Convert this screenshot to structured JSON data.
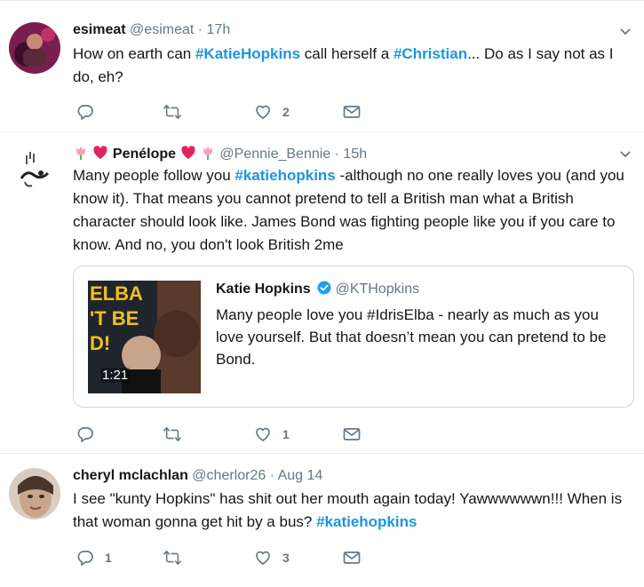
{
  "colors": {
    "link": "#1b95e0",
    "secondary": "#657786",
    "border": "#e6ecf0",
    "heart_emoji": "#e0245e"
  },
  "tweets": [
    {
      "name": "esimeat",
      "handle": "@esimeat",
      "dot": "·",
      "time": "17h",
      "text_parts": [
        "How on earth can ",
        "#KatieHopkins",
        " call herself a ",
        "#Christian",
        "... Do as I say not as I do, eh?"
      ],
      "reply_count": "",
      "retweet_count": "",
      "like_count": "2"
    },
    {
      "name": "Penélope",
      "handle": "@Pennie_Bennie",
      "dot": "·",
      "time": "15h",
      "name_icons": [
        "tulip-icon",
        "heart-icon"
      ],
      "text_parts": [
        "Many people follow you ",
        "#katiehopkins",
        " -although no one really loves you (and you know it). That means you cannot pretend to tell a British man what a British character should look like. James Bond was fighting people like you if you care to know. And no, you don't look British 2me"
      ],
      "quote": {
        "name": "Katie Hopkins",
        "handle": "@KTHopkins",
        "text": "Many people love you #IdrisElba - nearly as much as you love yourself. But that doesn’t mean you can pretend to be Bond.",
        "media_text": [
          "ELBA",
          "'T BE",
          "D!"
        ],
        "duration": "1:21"
      },
      "reply_count": "",
      "retweet_count": "",
      "like_count": "1"
    },
    {
      "name": "cheryl mclachlan",
      "handle": "@cherlor26",
      "dot": "·",
      "time": "Aug 14",
      "text_parts": [
        "I see \"kunty Hopkins\" has shit out her mouth again today! Yawwwwwwn!!! When is that woman gonna get hit by a bus? ",
        "#katiehopkins",
        ""
      ],
      "reply_count": "1",
      "retweet_count": "",
      "like_count": "3"
    }
  ]
}
